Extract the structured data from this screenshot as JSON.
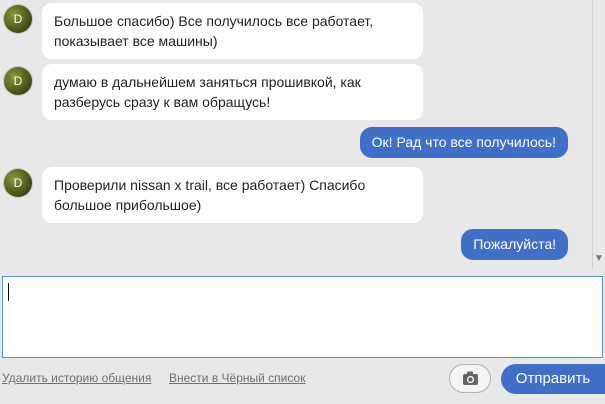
{
  "messages": [
    {
      "side": "in",
      "avatar_letter": "D",
      "text_lines": [
        "Большое спасибо) Все получилось все работает,",
        "показывает все машины)"
      ]
    },
    {
      "side": "in",
      "avatar_letter": "D",
      "text_lines": [
        "думаю в дальнейшем заняться прошивкой, как",
        "разберусь сразу к вам обращусь!"
      ]
    },
    {
      "side": "out",
      "text": "Ок! Рад что все получилось!"
    },
    {
      "side": "in",
      "avatar_letter": "D",
      "text_lines": [
        "Проверили nissan x trail, все работает) Спасибо",
        "большое прибольшое)"
      ]
    },
    {
      "side": "out",
      "text": "Пожалуйста!"
    }
  ],
  "composer": {
    "value": ""
  },
  "footer": {
    "clear_history_label": "Удалить историю общения",
    "blacklist_label": "Внести в Чёрный список",
    "photo_icon": "camera-icon",
    "send_label": "Отправить"
  },
  "colors": {
    "accent": "#3f6fc7",
    "background": "#e8e8e8",
    "bubble_in": "#ffffff"
  }
}
